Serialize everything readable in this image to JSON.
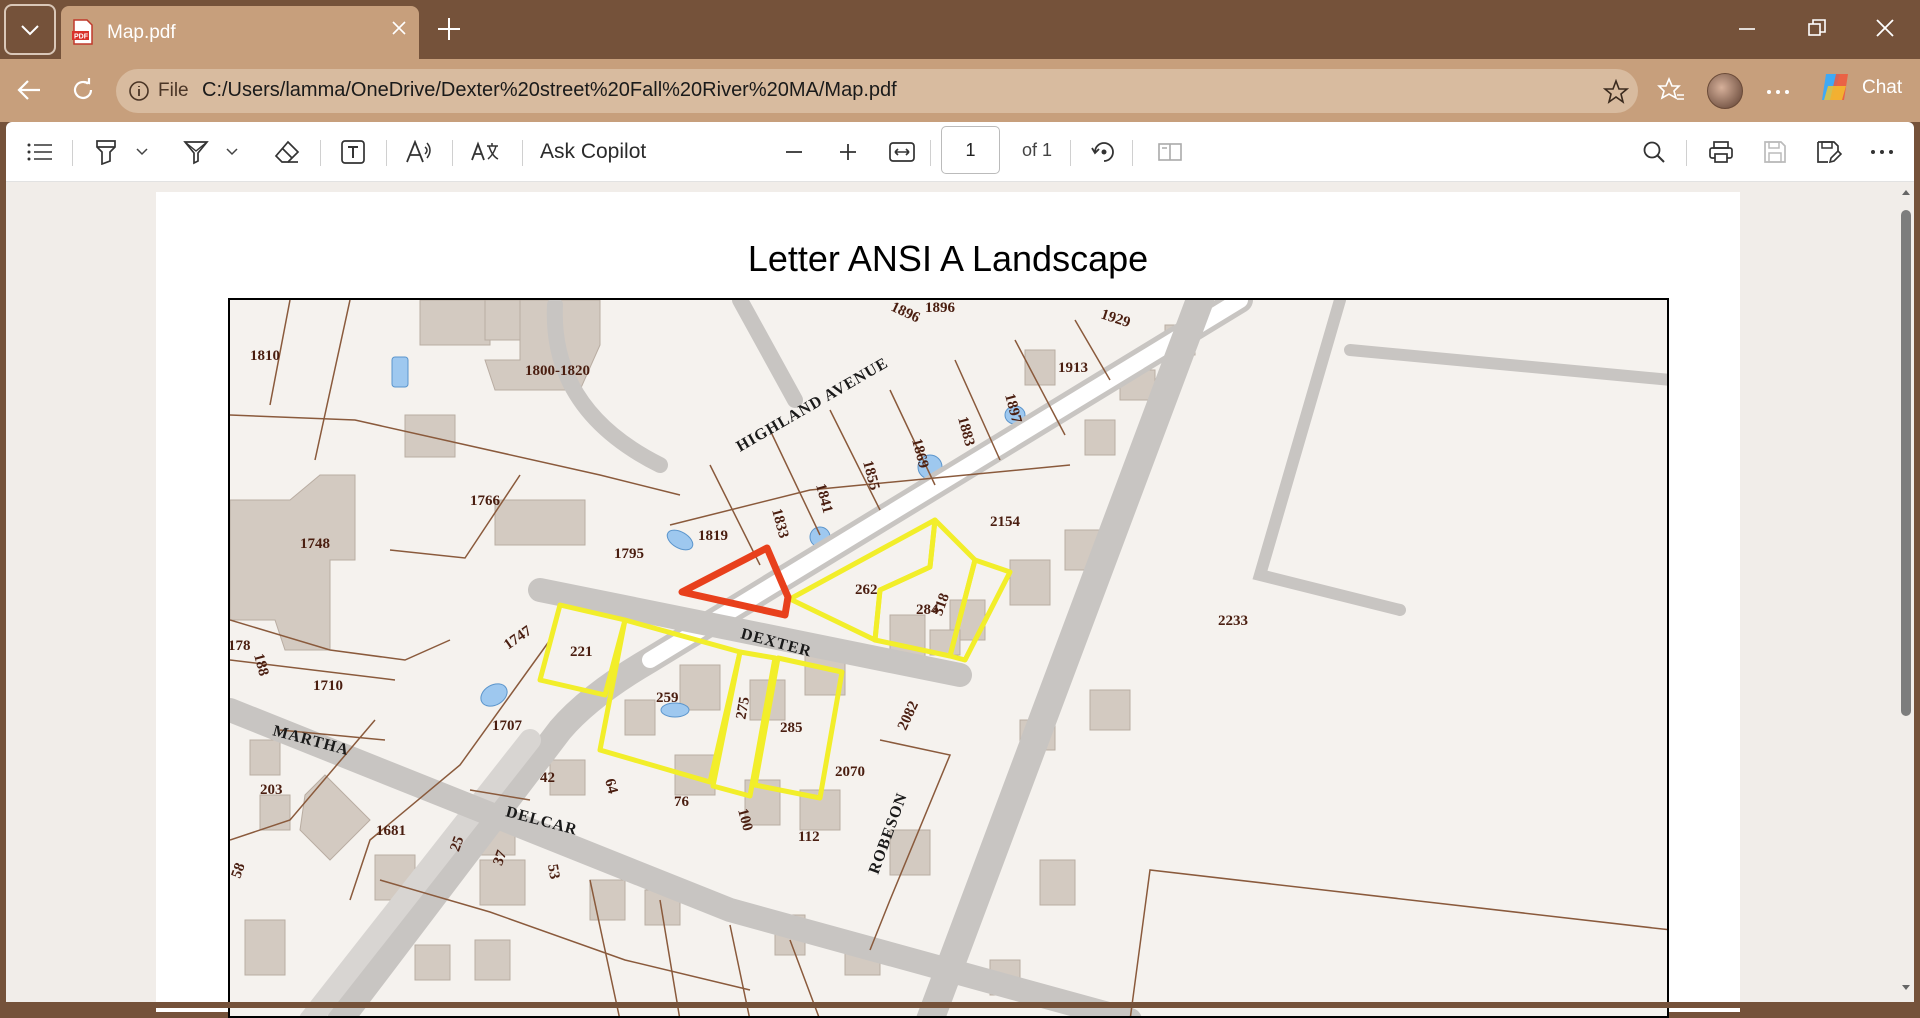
{
  "browser": {
    "tab": {
      "title": "Map.pdf"
    },
    "address": {
      "scheme_label": "File",
      "url": "C:/Users/lamma/OneDrive/Dexter%20street%20Fall%20River%20MA/Map.pdf"
    },
    "copilot_chat_label": "Chat",
    "icons": [
      "tab-actions-icon",
      "pdf-file-icon",
      "close-tab-icon",
      "new-tab-icon",
      "minimize-icon",
      "restore-icon",
      "close-window-icon",
      "back-icon",
      "refresh-icon",
      "info-icon",
      "favorite-star-icon",
      "favorites-icon",
      "profile-avatar",
      "more-icon",
      "copilot-icon"
    ]
  },
  "pdf_toolbar": {
    "ask_copilot": "Ask Copilot",
    "current_page": "1",
    "page_total": "of 1",
    "icons": [
      "contents-icon",
      "highlight-icon",
      "draw-icon",
      "eraser-icon",
      "text-box-icon",
      "read-aloud-icon",
      "translate-icon",
      "zoom-out-icon",
      "zoom-in-icon",
      "fit-to-width-icon",
      "rotate-icon",
      "page-view-icon",
      "search-icon",
      "print-icon",
      "save-icon",
      "save-as-icon",
      "more-icon"
    ]
  },
  "document": {
    "title": "Letter ANSI A Landscape",
    "map": {
      "streets": [
        "HIGHLAND AVENUE",
        "DEXTER",
        "MARTHA",
        "DELCAR",
        "ROBESON"
      ],
      "parcels": [
        "1810",
        "1800-1820",
        "1896",
        "1896",
        "1929",
        "1913",
        "1897",
        "1883",
        "1869",
        "1855",
        "1841",
        "1833",
        "1819",
        "1795",
        "1766",
        "1748",
        "2154",
        "262",
        "284",
        "318",
        "2233",
        "1747",
        "221",
        "259",
        "275",
        "285",
        "2082",
        "178",
        "188",
        "1710",
        "1707",
        "42",
        "64",
        "76",
        "2070",
        "203",
        "1681",
        "25",
        "37",
        "53",
        "58",
        "100",
        "112"
      ],
      "highlight_colors": {
        "subject_outline": "#e8401c",
        "adjacent_outline": "#f2ee2a"
      }
    }
  }
}
